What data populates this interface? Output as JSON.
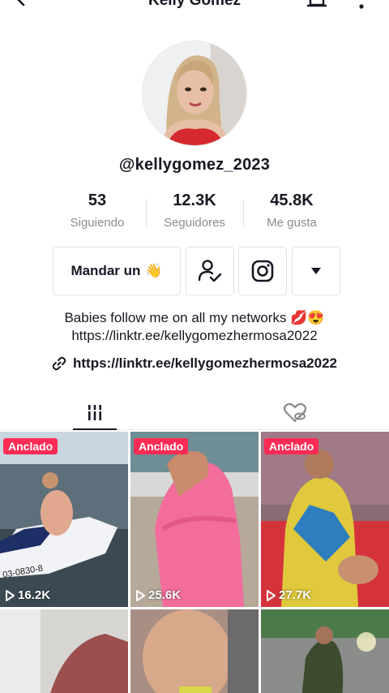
{
  "header": {
    "title": "Kelly Gomez",
    "icons": [
      "back-arrow-icon",
      "bell-icon",
      "more-vertical-icon"
    ]
  },
  "profile": {
    "username": "@kellygomez_2023",
    "stats": [
      {
        "value": "53",
        "label": "Siguiendo"
      },
      {
        "value": "12.3K",
        "label": "Seguidores"
      },
      {
        "value": "45.8K",
        "label": "Me gusta"
      }
    ],
    "actions": {
      "message_label": "Mandar un",
      "message_emoji": "👋",
      "follow_icon": "person-check-icon",
      "instagram_icon": "instagram-icon",
      "dropdown_icon": "caret-down-icon"
    },
    "bio": {
      "line1": "Babies follow me on all my networks 💋😍",
      "line2": "https://linktr.ee/kellygomezhermosa2022"
    },
    "link": "https://linktr.ee/kellygomezhermosa2022"
  },
  "tabs": {
    "videos_icon": "grid-bars-icon",
    "liked_icon": "hidden-heart-icon"
  },
  "videos": [
    {
      "badge": "Anclado",
      "views": "16.2K"
    },
    {
      "badge": "Anclado",
      "views": "25.6K"
    },
    {
      "badge": "Anclado",
      "views": "27.7K"
    },
    {
      "badge": "",
      "views": ""
    },
    {
      "badge": "",
      "views": ""
    },
    {
      "badge": "",
      "views": ""
    }
  ],
  "colors": {
    "accent": "#fe2c55",
    "text": "#161823",
    "muted": "#8a8b91",
    "border": "#e3e3e4"
  }
}
